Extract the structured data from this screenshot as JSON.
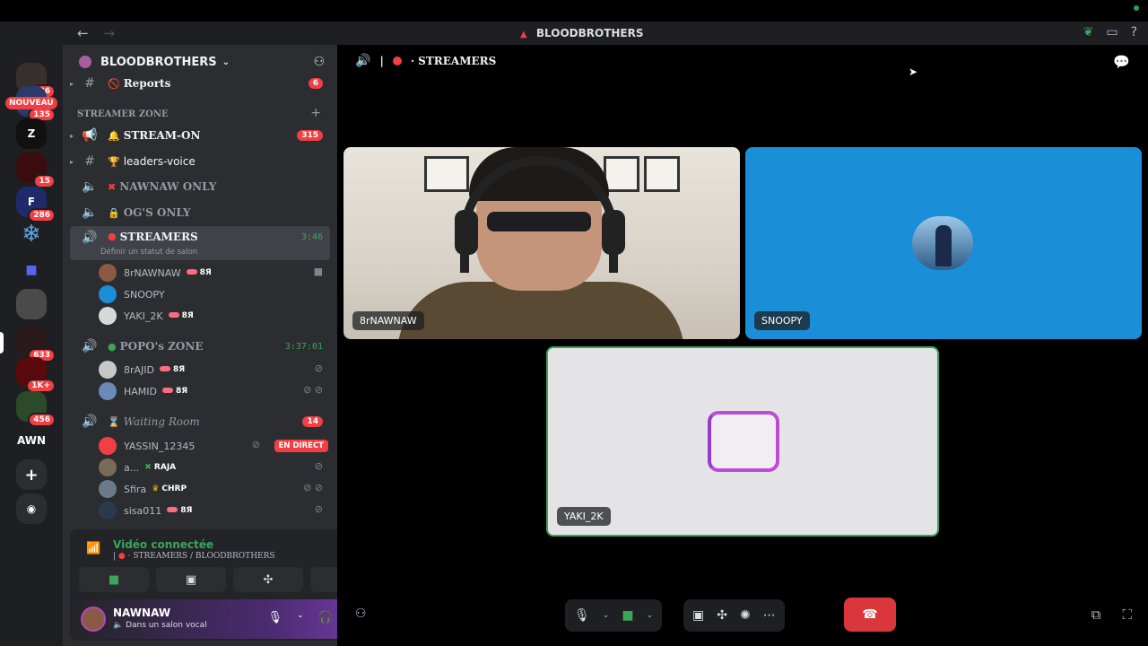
{
  "window": {
    "title": "BLOODBROTHERS",
    "back": "←",
    "forward": "→"
  },
  "servers": {
    "new_badge": "NOUVEAU",
    "items": [
      {
        "label": "",
        "badge": "86"
      },
      {
        "label": "",
        "badge": "135"
      },
      {
        "label": "Z",
        "badge": ""
      },
      {
        "label": "",
        "badge": "15"
      },
      {
        "label": "F",
        "badge": "286"
      },
      {
        "label": "❄",
        "badge": ""
      },
      {
        "label": "■",
        "badge": ""
      },
      {
        "label": "",
        "badge": ""
      },
      {
        "label": "",
        "badge": "633"
      },
      {
        "label": "",
        "badge": "1K+"
      },
      {
        "label": "",
        "badge": "456"
      },
      {
        "label": "AWN",
        "badge": ""
      },
      {
        "label": "+",
        "badge": ""
      },
      {
        "label": "◉",
        "badge": ""
      }
    ]
  },
  "guild": {
    "name": "BLOODBROTHERS",
    "chevron": "⌄"
  },
  "channels": {
    "reports": {
      "icon": "#",
      "emoji": "🚫",
      "name": "Reports",
      "count": "6"
    },
    "category": "STREAMER ZONE",
    "stream_on": {
      "icon": "📢",
      "emoji": "🔔",
      "name": "STREAM-ON",
      "count": "315"
    },
    "leaders": {
      "icon": "#",
      "emoji": "🏆",
      "name": "leaders-voice"
    },
    "nawnaw": {
      "emoji": "✖",
      "name": "NAWNAW ONLY"
    },
    "ogs": {
      "emoji": "🔒",
      "name": "OG'S ONLY"
    },
    "streamers": {
      "name": "STREAMERS",
      "time": "3:46",
      "status_hint": "Définir un statut de salon"
    },
    "streamers_users": [
      {
        "name": "8rNAWNAW",
        "tag": "8Я"
      },
      {
        "name": "SNOOPY",
        "tag": ""
      },
      {
        "name": "YAKI_2K",
        "tag": "8Я"
      }
    ],
    "popo": {
      "name": "POPO's ZONE",
      "time": "3:37:01"
    },
    "popo_users": [
      {
        "name": "8rAJID",
        "tag": "8Я"
      },
      {
        "name": "HAMID",
        "tag": "8Я"
      }
    ],
    "waiting": {
      "name": "Waiting Room",
      "count": "14"
    },
    "waiting_users": [
      {
        "name": "YASSIN_12345",
        "tag": "",
        "live": "EN DIRECT"
      },
      {
        "name": "a...",
        "tag": "RAJA"
      },
      {
        "name": "Sfira",
        "tag": "CHRP"
      },
      {
        "name": "sisa011",
        "tag": "8Я"
      }
    ]
  },
  "voice_panel": {
    "title": "Vidéo connectée",
    "subtitle": "STREAMERS / BLOODBROTHERS"
  },
  "user": {
    "name": "NAWNAW",
    "status": "Dans un salon vocal"
  },
  "stage": {
    "channel_name": "STREAMERS",
    "tiles": [
      {
        "label": "8rNAWNAW"
      },
      {
        "label": "SNOOPY"
      },
      {
        "label": "YAKI_2K"
      }
    ]
  },
  "colors": {
    "accent_green": "#3ba55c",
    "danger_red": "#f23f43",
    "snoopy_bg": "#1a8fd8"
  }
}
